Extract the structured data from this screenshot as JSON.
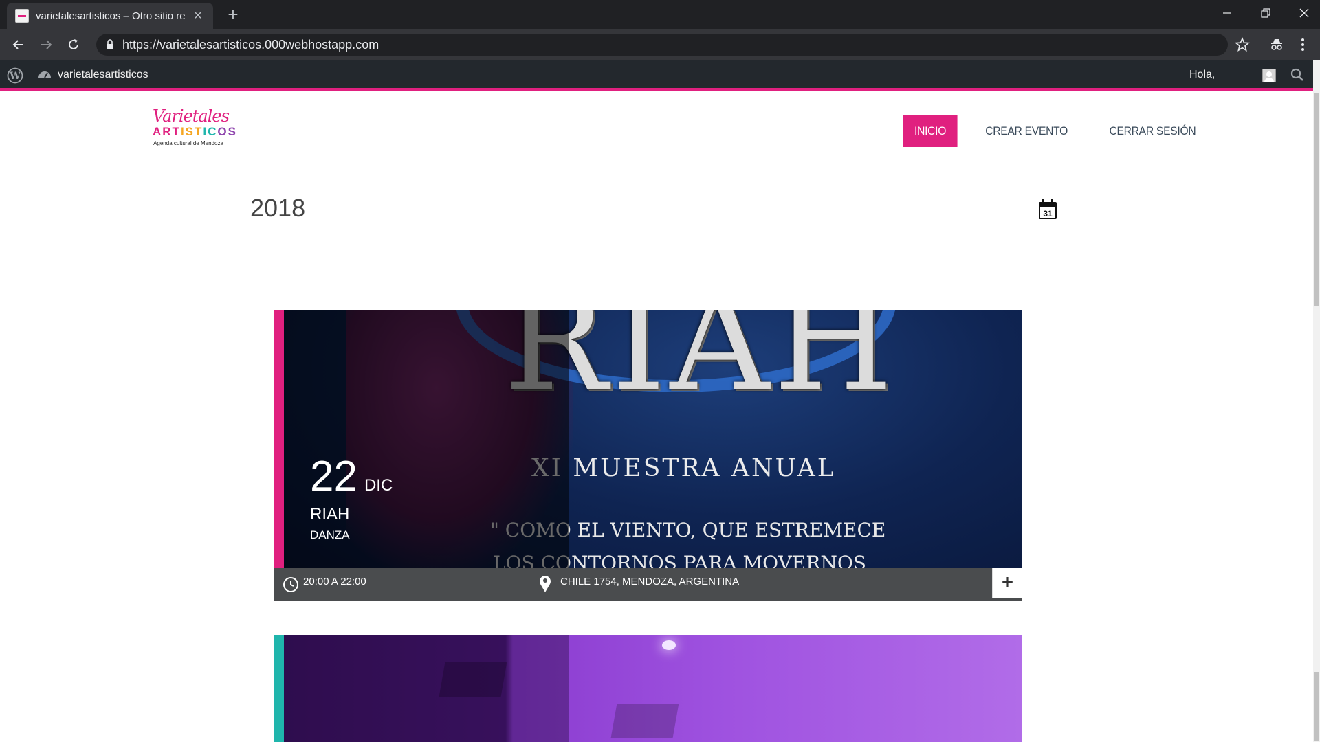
{
  "browser": {
    "tab_title": "varietalesartisticos – Otro sitio re",
    "url": "https://varietalesartisticos.000webhostapp.com"
  },
  "adminbar": {
    "site_name": "varietalesartisticos",
    "greeting": "Hola,"
  },
  "site": {
    "logo": {
      "line1": "Varietales",
      "line2": [
        "ART",
        "IST",
        "IC",
        "OS"
      ],
      "tagline": "Agenda cultural de Mendoza"
    },
    "nav": {
      "items": [
        {
          "label": "INICIO",
          "active": true
        },
        {
          "label": "CREAR EVENTO",
          "active": false
        },
        {
          "label": "CERRAR SESIÓN",
          "active": false
        }
      ]
    },
    "year": "2018",
    "calendar_day": "31"
  },
  "events": [
    {
      "day": "22",
      "month": "DIC",
      "title": "RIAH",
      "category": "DANZA",
      "time": "20:00 A 22:00",
      "address": "CHILE 1754, MENDOZA, ARGENTINA",
      "stripe_color": "#e0207f",
      "poster": {
        "title": "RIAH",
        "line1": "XI  MUESTRA  ANUAL",
        "line2": "\" COMO EL VIENTO, QUE ESTREMECE",
        "line3": "LOS CONTORNOS PARA MOVERNOS"
      }
    },
    {
      "stripe_color": "#1fb5ac"
    }
  ],
  "colors": {
    "accent": "#e0207f",
    "chrome_dark": "#202124",
    "adminbar": "#23282d",
    "event_bar": "#4a4c4e"
  }
}
